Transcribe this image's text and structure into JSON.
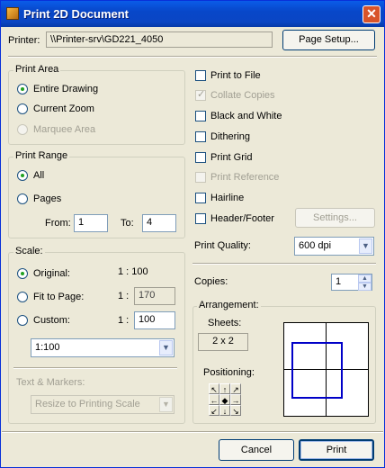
{
  "window": {
    "title": "Print 2D Document"
  },
  "printer": {
    "label": "Printer:",
    "name": "\\\\Printer-srv\\GD221_4050",
    "setup_button": "Page Setup..."
  },
  "print_area": {
    "title": "Print Area",
    "options": [
      {
        "label": "Entire Drawing",
        "selected": true,
        "enabled": true
      },
      {
        "label": "Current Zoom",
        "selected": false,
        "enabled": true
      },
      {
        "label": "Marquee Area",
        "selected": false,
        "enabled": false
      }
    ]
  },
  "print_range": {
    "title": "Print Range",
    "all_label": "All",
    "pages_label": "Pages",
    "from_label": "From:",
    "from_value": "1",
    "to_label": "To:",
    "to_value": "4"
  },
  "scale": {
    "title": "Scale:",
    "original_label": "Original:",
    "original_ratio": "1 : 100",
    "fit_label": "Fit to Page:",
    "fit_prefix": "1 :",
    "fit_value": "170",
    "custom_label": "Custom:",
    "custom_prefix": "1 :",
    "custom_value": "100",
    "dropdown_value": "1:100"
  },
  "text_markers": {
    "label": "Text & Markers:",
    "dropdown_value": "Resize to Printing Scale"
  },
  "options": {
    "print_to_file": "Print to File",
    "collate_copies": "Collate Copies",
    "black_and_white": "Black and White",
    "dithering": "Dithering",
    "print_grid": "Print Grid",
    "print_reference": "Print Reference",
    "hairline": "Hairline",
    "header_footer": "Header/Footer",
    "settings_button": "Settings..."
  },
  "quality": {
    "label": "Print Quality:",
    "value": "600 dpi"
  },
  "copies": {
    "label": "Copies:",
    "value": "1"
  },
  "arrangement": {
    "title": "Arrangement:",
    "sheets_label": "Sheets:",
    "sheets_value": "2 x 2",
    "positioning_label": "Positioning:"
  },
  "buttons": {
    "cancel": "Cancel",
    "print": "Print"
  }
}
